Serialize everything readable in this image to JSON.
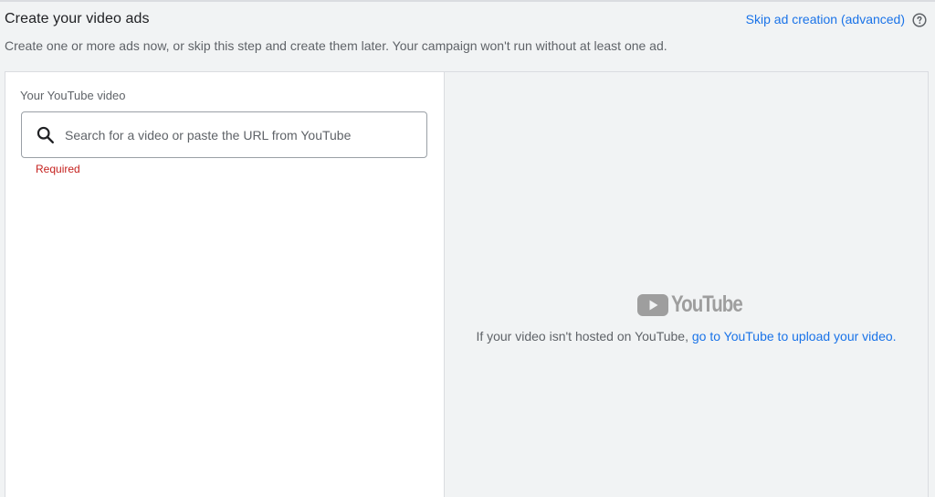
{
  "header": {
    "title": "Create your video ads",
    "subtitle": "Create one or more ads now, or skip this step and create them later. Your campaign won't run without at least one ad.",
    "skip_link": "Skip ad creation (advanced)",
    "help_icon": "help-circle-icon"
  },
  "video_field": {
    "label": "Your YouTube video",
    "placeholder": "Search for a video or paste the URL from YouTube",
    "value": "",
    "error": "Required",
    "icon": "search-icon"
  },
  "preview": {
    "logo_text": "YouTube",
    "note_prefix": "If your video isn't hosted on YouTube, ",
    "note_link": "go to YouTube to upload your video."
  },
  "colors": {
    "link": "#1a73e8",
    "error": "#c5221f",
    "logo_gray": "#9e9e9e"
  }
}
